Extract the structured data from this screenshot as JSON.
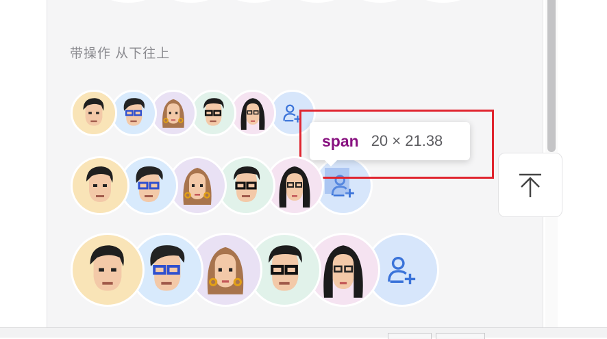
{
  "section": {
    "title": "带操作 从下往上"
  },
  "avatars": [
    {
      "name": "avatar-man-black-hair",
      "bg": "#f9e4b7"
    },
    {
      "name": "avatar-man-blue-glasses",
      "bg": "#d8eafc"
    },
    {
      "name": "avatar-woman-brown-hair",
      "bg": "#e9e1f4"
    },
    {
      "name": "avatar-man-black-glasses",
      "bg": "#e1f2ea"
    },
    {
      "name": "avatar-woman-long-black-hair",
      "bg": "#f5e3f1"
    }
  ],
  "add_button": {
    "icon": "add-user-icon",
    "bg": "#d7e6fb",
    "color": "#3a73d9"
  },
  "tooltip": {
    "tag": "span",
    "size": "20 × 21.38"
  },
  "colors": {
    "highlight_box": "#e0252f",
    "tag": "#881280"
  },
  "back_to_top": {
    "icon": "arrow-up-to-top-icon"
  }
}
